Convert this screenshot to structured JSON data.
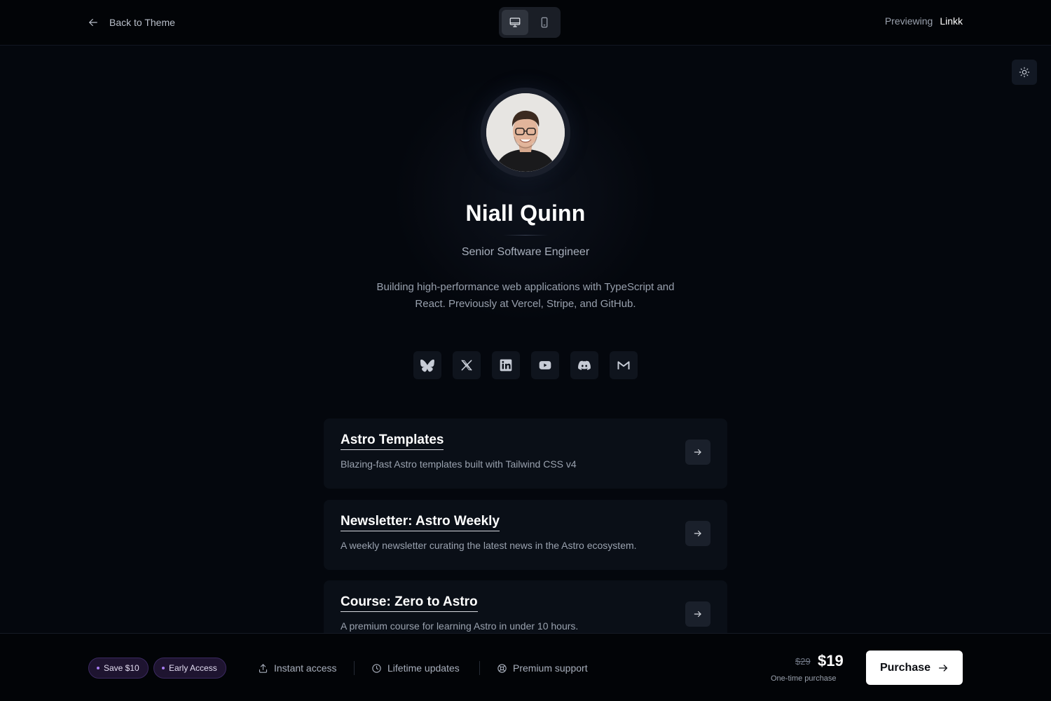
{
  "topbar": {
    "back_label": "Back to Theme",
    "previewing_label": "Previewing",
    "theme_name": "Linkk",
    "devices": [
      {
        "name": "desktop",
        "active": true
      },
      {
        "name": "mobile",
        "active": false
      }
    ]
  },
  "profile": {
    "name": "Niall Quinn",
    "role": "Senior Software Engineer",
    "bio": "Building high-performance web applications with TypeScript and React. Previously at Vercel, Stripe, and GitHub."
  },
  "socials": [
    "bluesky-icon",
    "x-icon",
    "linkedin-icon",
    "youtube-icon",
    "discord-icon",
    "gmail-icon"
  ],
  "links": [
    {
      "title": "Astro Templates",
      "description": "Blazing-fast Astro templates built with Tailwind CSS v4"
    },
    {
      "title": "Newsletter: Astro Weekly",
      "description": "A weekly newsletter curating the latest news in the Astro ecosystem."
    },
    {
      "title": "Course: Zero to Astro",
      "description": "A premium course for learning Astro in under 10 hours."
    }
  ],
  "purchase_bar": {
    "badges": [
      "Save $10",
      "Early Access"
    ],
    "features": [
      "Instant access",
      "Lifetime updates",
      "Premium support"
    ],
    "old_price": "$29",
    "price": "$19",
    "price_note": "One-time purchase",
    "button_label": "Purchase"
  },
  "colors": {
    "background": "#04070d",
    "card": "#0a0f17",
    "badge_accent": "#a77cf2",
    "button": "#ffffff"
  }
}
